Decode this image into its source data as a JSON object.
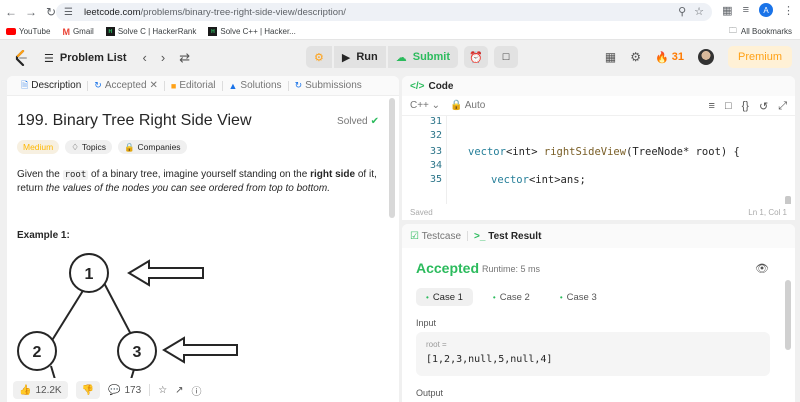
{
  "browser": {
    "url_host": "leetcode.com",
    "url_path": "/problems/binary-tree-right-side-view/description/",
    "profile_initial": "A",
    "bookmarks": [
      {
        "label": "YouTube"
      },
      {
        "label": "Gmail"
      },
      {
        "label": "Solve C | HackerRank"
      },
      {
        "label": "Solve C++ | Hacker..."
      }
    ],
    "all_bookmarks": "All Bookmarks"
  },
  "topbar": {
    "problem_list": "Problem List",
    "run": "Run",
    "submit": "Submit",
    "streak": "31",
    "premium": "Premium"
  },
  "left_tabs": [
    {
      "label": "Description"
    },
    {
      "label": "Accepted"
    },
    {
      "label": "Editorial"
    },
    {
      "label": "Solutions"
    },
    {
      "label": "Submissions"
    }
  ],
  "problem": {
    "title": "199. Binary Tree Right Side View",
    "status": "Solved",
    "difficulty": "Medium",
    "topics": "Topics",
    "companies": "Companies",
    "desc_1": "Given the ",
    "desc_code": "root",
    "desc_2": " of a binary tree, imagine yourself standing on the ",
    "desc_bold": "right side",
    "desc_3": " of it, return",
    "desc_italic": "the values of the nodes you can see ordered from top to bottom.",
    "example_title": "Example 1:",
    "tree_nodes": [
      "1",
      "2",
      "3"
    ]
  },
  "footer": {
    "likes": "12.2K",
    "comments": "173"
  },
  "code_panel": {
    "title": "Code",
    "language": "C++",
    "mode": "Auto",
    "lines": [
      "31",
      "32",
      "33",
      "34",
      "35"
    ],
    "line33_type": "vector",
    "line33_generic": "<int>",
    "line33_fn": " rightSideView",
    "line33_args": "(TreeNode* root) {",
    "line35_type": "vector",
    "line35_rest": "<int>ans;",
    "saved": "Saved",
    "cursor": "Ln 1, Col 1"
  },
  "test_panel": {
    "tab_testcase": "Testcase",
    "tab_result": "Test Result",
    "result": "Accepted",
    "runtime": "Runtime: 5 ms",
    "cases": [
      "Case 1",
      "Case 2",
      "Case 3"
    ],
    "input_label": "Input",
    "input_key": "root =",
    "input_value": "[1,2,3,null,5,null,4]",
    "output_label": "Output"
  },
  "colors": {
    "accent_green": "#2cbb5d",
    "premium_orange": "#ffa116",
    "medium": "#ffb800"
  }
}
